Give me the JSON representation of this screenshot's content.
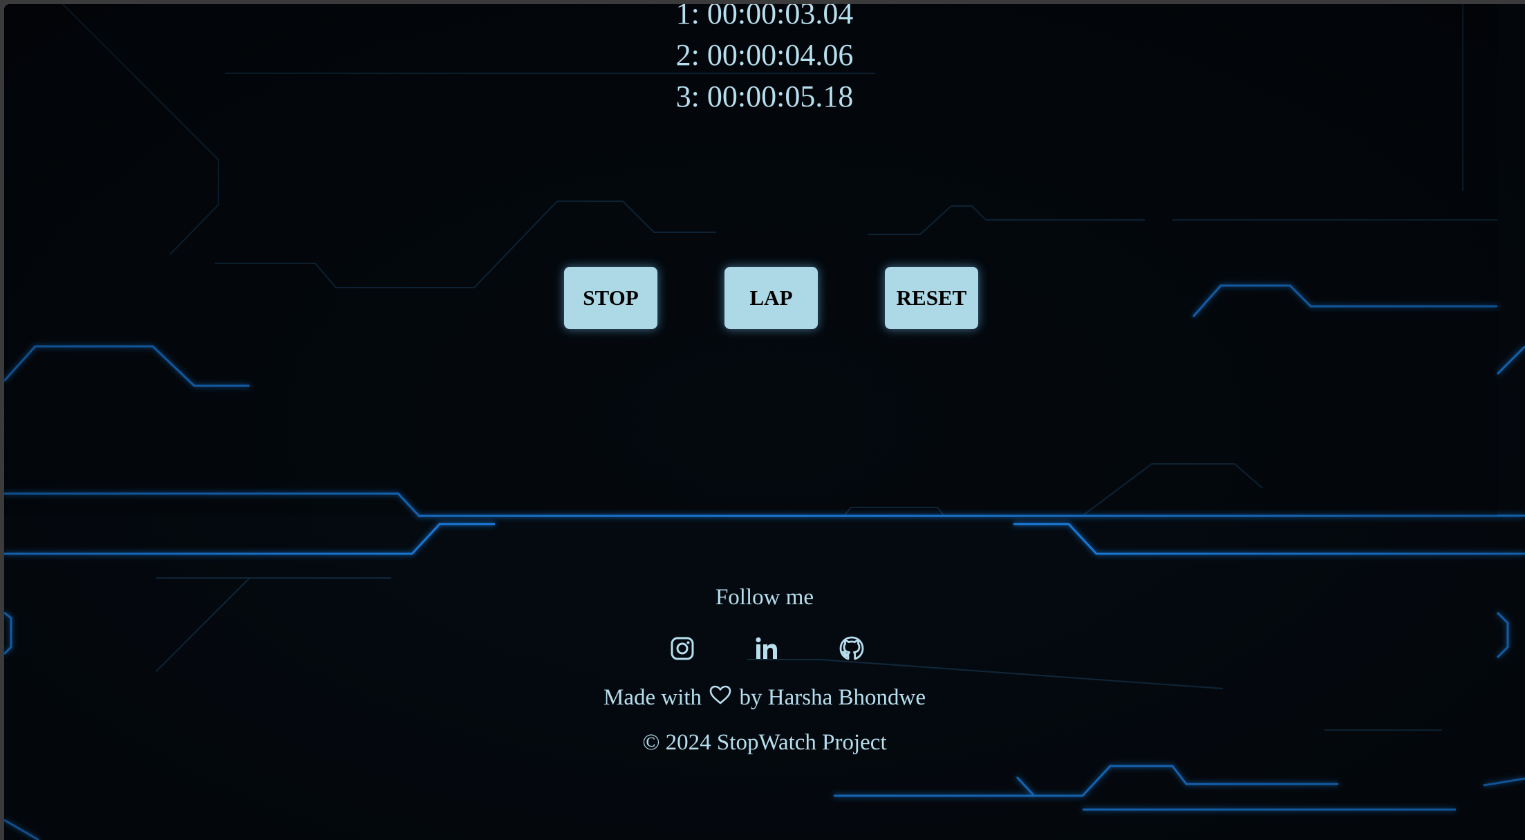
{
  "laps": [
    "1: 00:00:03.04",
    "2: 00:00:04.06",
    "3: 00:00:05.18"
  ],
  "controls": {
    "stop_label": "STOP",
    "lap_label": "LAP",
    "reset_label": "RESET"
  },
  "footer": {
    "follow_label": "Follow me",
    "socials": [
      {
        "icon": "instagram-icon"
      },
      {
        "icon": "linkedin-icon"
      },
      {
        "icon": "github-icon"
      }
    ],
    "made_with": "Made with",
    "made_by": "by Harsha Bhondwe",
    "heart_icon": "heart-outline-icon",
    "copyright": "© 2024 StopWatch Project"
  },
  "colors": {
    "background": "#03070b",
    "text": "#b7dfee",
    "button": "#add8e6",
    "circuit_glow": "#1e90ff"
  }
}
